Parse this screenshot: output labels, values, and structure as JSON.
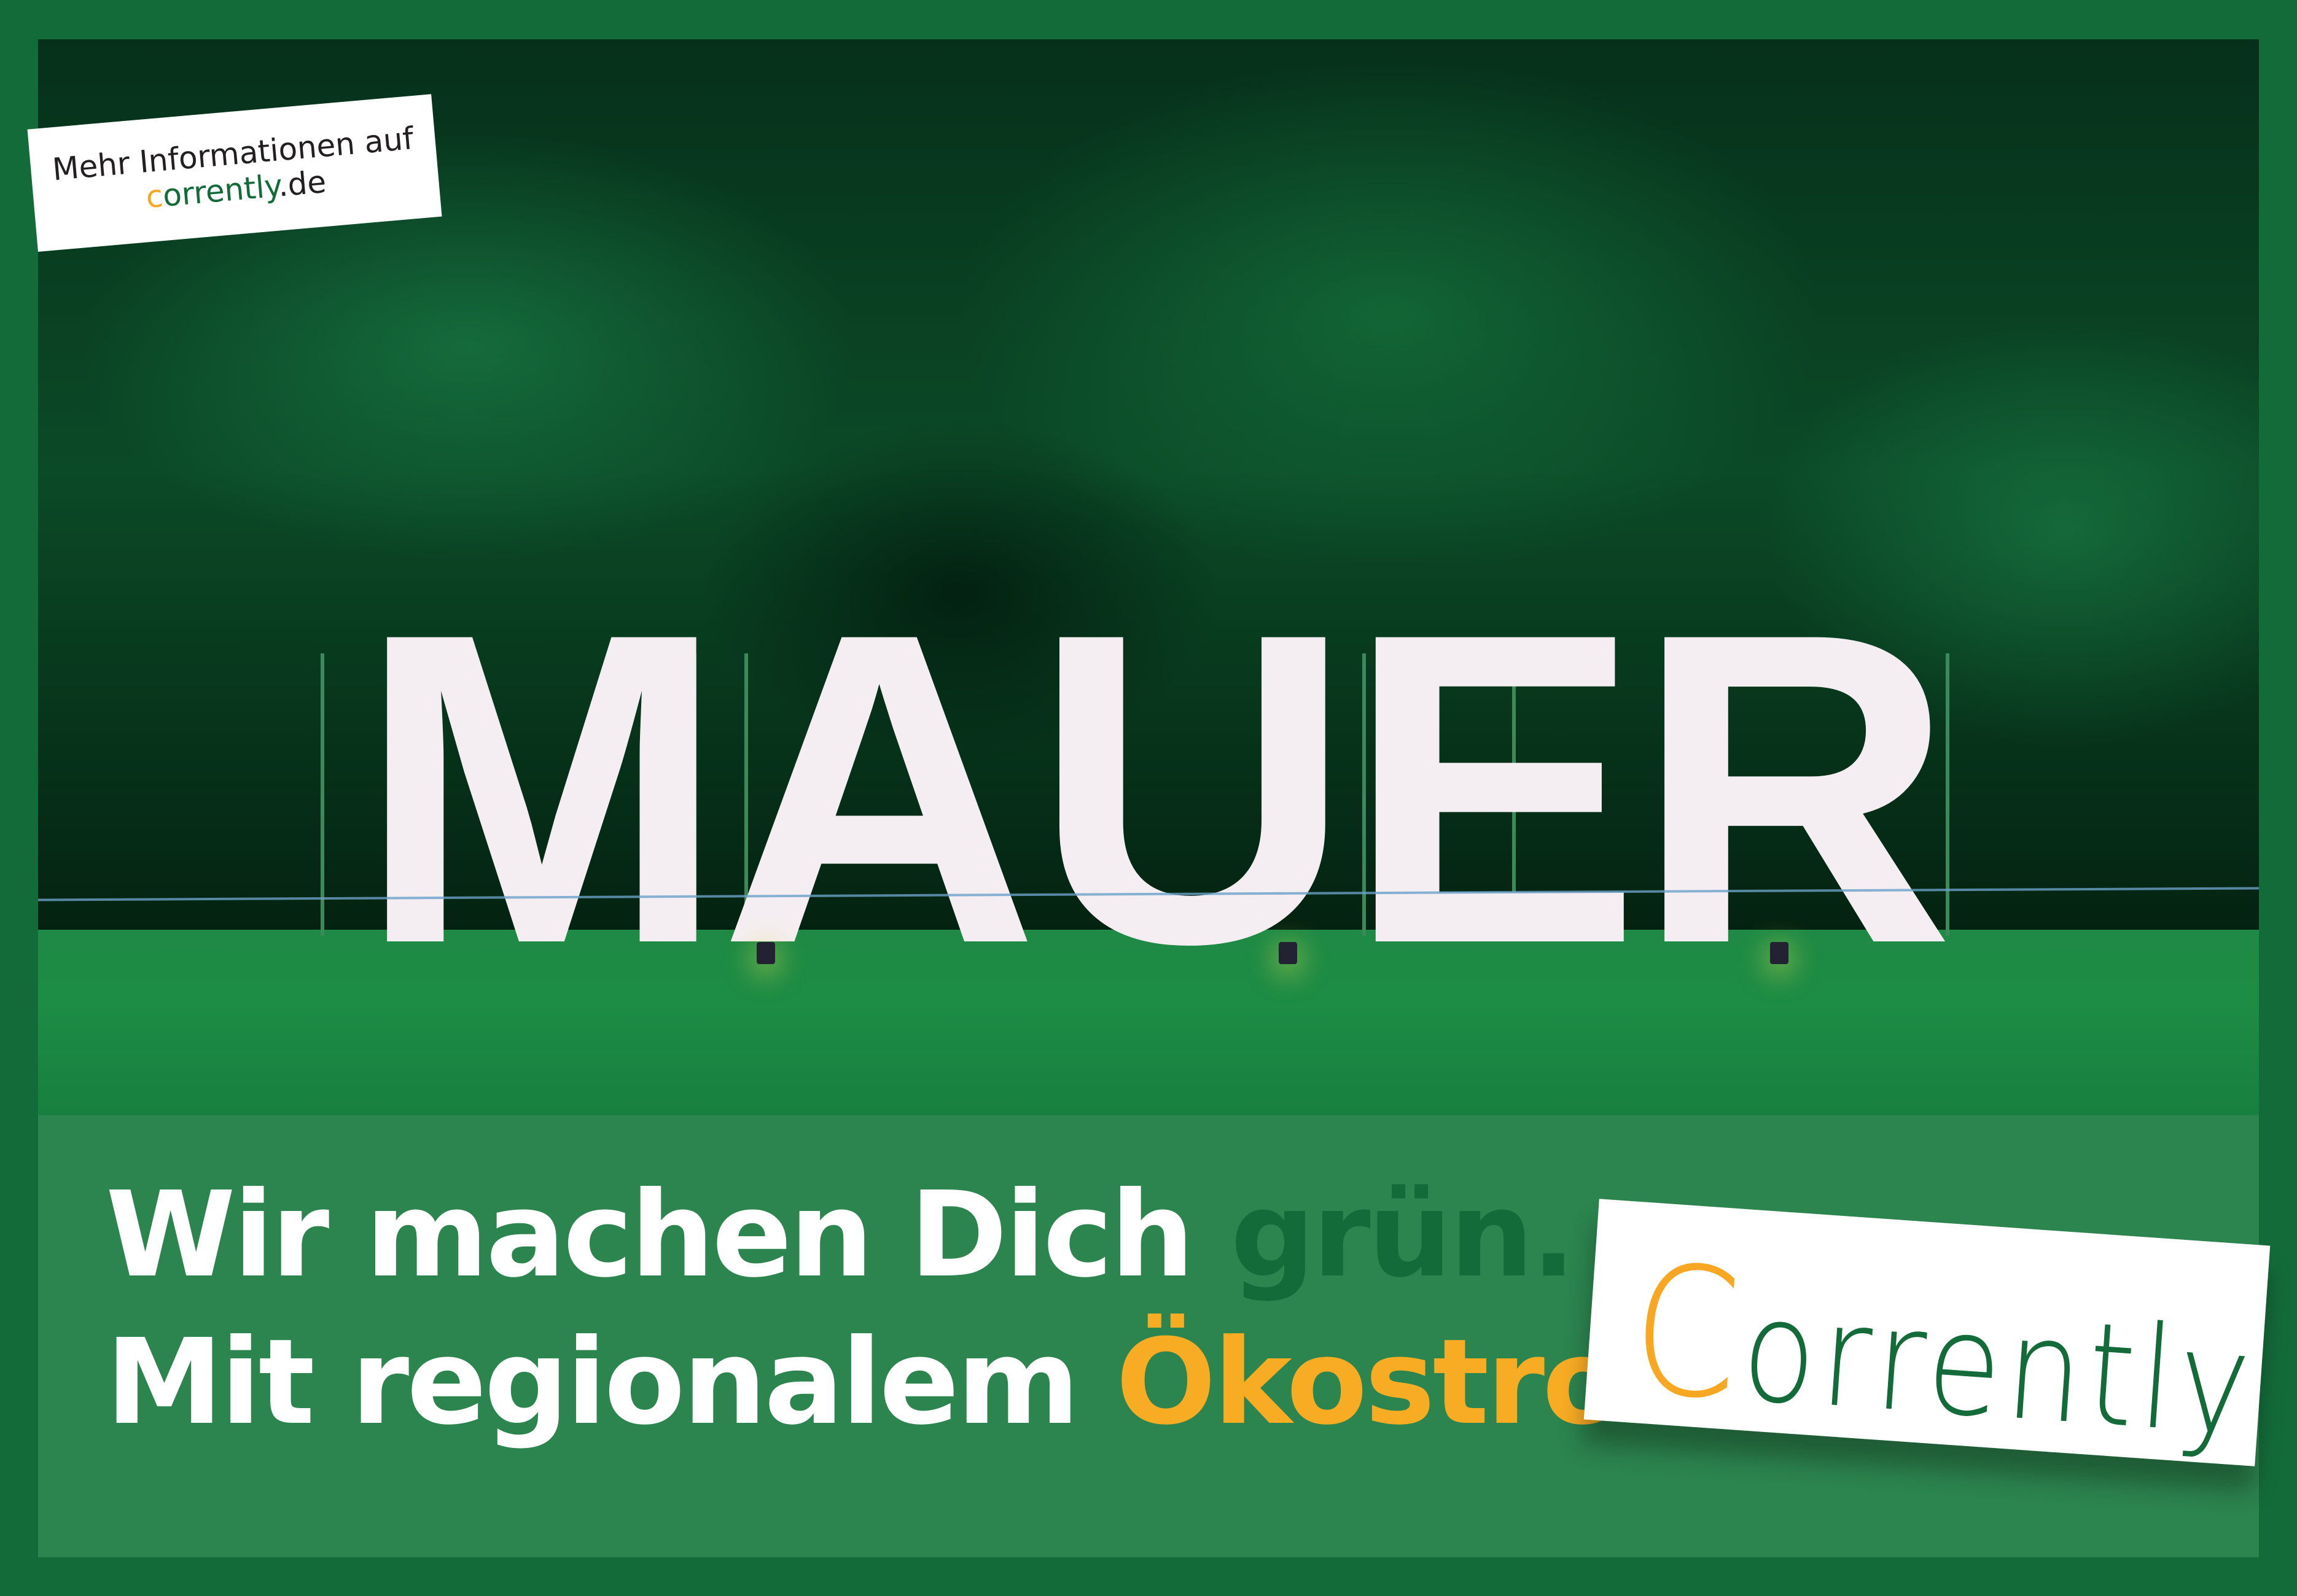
{
  "info_card": {
    "line1": "Mehr Informationen auf",
    "domain_first": "c",
    "domain_rest": "orrently",
    "domain_tld": ".de"
  },
  "photo": {
    "sign_text": "MAUER"
  },
  "headline": {
    "line1_prefix": "Wir machen Dich ",
    "line1_accent": "grün.",
    "line2_prefix": "Mit regionalem ",
    "line2_accent": "Ökostrom."
  },
  "logo": {
    "first": "C",
    "rest": "orrently"
  },
  "colors": {
    "frame": "#146b3a",
    "panel": "#2c844e",
    "orange": "#f8a723",
    "dark_green": "#146b3a"
  }
}
